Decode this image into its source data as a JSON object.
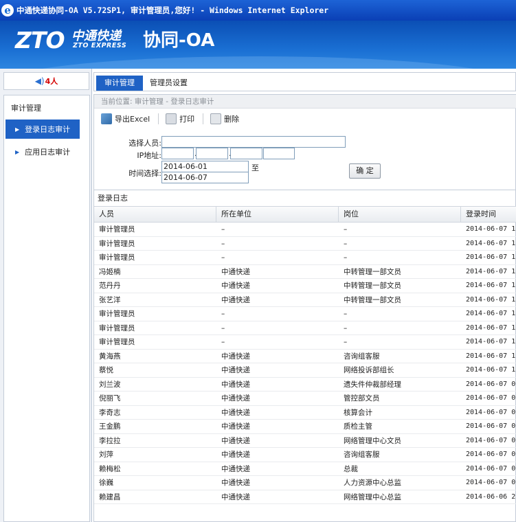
{
  "window": {
    "title": "中通快递协同-OA V5.72SP1, 审计管理员,您好! - Windows Internet Explorer"
  },
  "banner": {
    "logo_mark": "ZTO",
    "logo_cn": "中通快递",
    "logo_en": "ZTO EXPRESS",
    "app_name": "协同-OA"
  },
  "sidebar": {
    "online_count": "4人",
    "heading": "审计管理",
    "items": [
      {
        "label": "登录日志审计",
        "active": true
      },
      {
        "label": "应用日志审计",
        "active": false
      }
    ]
  },
  "tabs": [
    {
      "label": "审计管理",
      "active": true
    },
    {
      "label": "管理员设置",
      "active": false
    }
  ],
  "breadcrumb": "当前位置:  审计管理 - 登录日志审计",
  "toolbar": {
    "export_label": "导出Excel",
    "print_label": "打印",
    "delete_label": "删除"
  },
  "filter": {
    "person_label": "选择人员:",
    "person_value": "",
    "ip_label": "IP地址:",
    "time_label": "时间选择:",
    "start_date": "2014-06-01",
    "end_date": "2014-06-07",
    "to_label": "至",
    "confirm_label": "确 定"
  },
  "log": {
    "title": "登录日志",
    "columns": [
      "人员",
      "所在单位",
      "岗位",
      "登录时间"
    ],
    "rows": [
      [
        "审计管理员",
        "–",
        "–",
        "2014-06-07 1"
      ],
      [
        "审计管理员",
        "–",
        "–",
        "2014-06-07 1"
      ],
      [
        "审计管理员",
        "–",
        "–",
        "2014-06-07 1"
      ],
      [
        "冯姬楠",
        "中通快递",
        "中转管理一部文员",
        "2014-06-07 1"
      ],
      [
        "范丹丹",
        "中通快递",
        "中转管理一部文员",
        "2014-06-07 1"
      ],
      [
        "张艺洋",
        "中通快递",
        "中转管理一部文员",
        "2014-06-07 1"
      ],
      [
        "审计管理员",
        "–",
        "–",
        "2014-06-07 1"
      ],
      [
        "审计管理员",
        "–",
        "–",
        "2014-06-07 1"
      ],
      [
        "审计管理员",
        "–",
        "–",
        "2014-06-07 1"
      ],
      [
        "黄海燕",
        "中通快递",
        "咨询组客服",
        "2014-06-07 1"
      ],
      [
        "蔡悦",
        "中通快递",
        "网络投诉部组长",
        "2014-06-07 1"
      ],
      [
        "刘兰波",
        "中通快递",
        "遗失件仲裁部经理",
        "2014-06-07 0"
      ],
      [
        "倪丽飞",
        "中通快递",
        "管控部文员",
        "2014-06-07 0"
      ],
      [
        "李奇志",
        "中通快递",
        "核算会计",
        "2014-06-07 0"
      ],
      [
        "王金鹏",
        "中通快递",
        "质检主管",
        "2014-06-07 0"
      ],
      [
        "李拉拉",
        "中通快递",
        "网络管理中心文员",
        "2014-06-07 0"
      ],
      [
        "刘萍",
        "中通快递",
        "咨询组客服",
        "2014-06-07 0"
      ],
      [
        "赖梅松",
        "中通快递",
        "总裁",
        "2014-06-07 0"
      ],
      [
        "徐巍",
        "中通快递",
        "人力资源中心总监",
        "2014-06-07 0"
      ],
      [
        "赖建昌",
        "中通快递",
        "网络管理中心总监",
        "2014-06-06 2"
      ]
    ]
  },
  "colors": {
    "accent": "#1f62c5",
    "banner": "#1a6fd3",
    "online_count": "#d40000"
  }
}
